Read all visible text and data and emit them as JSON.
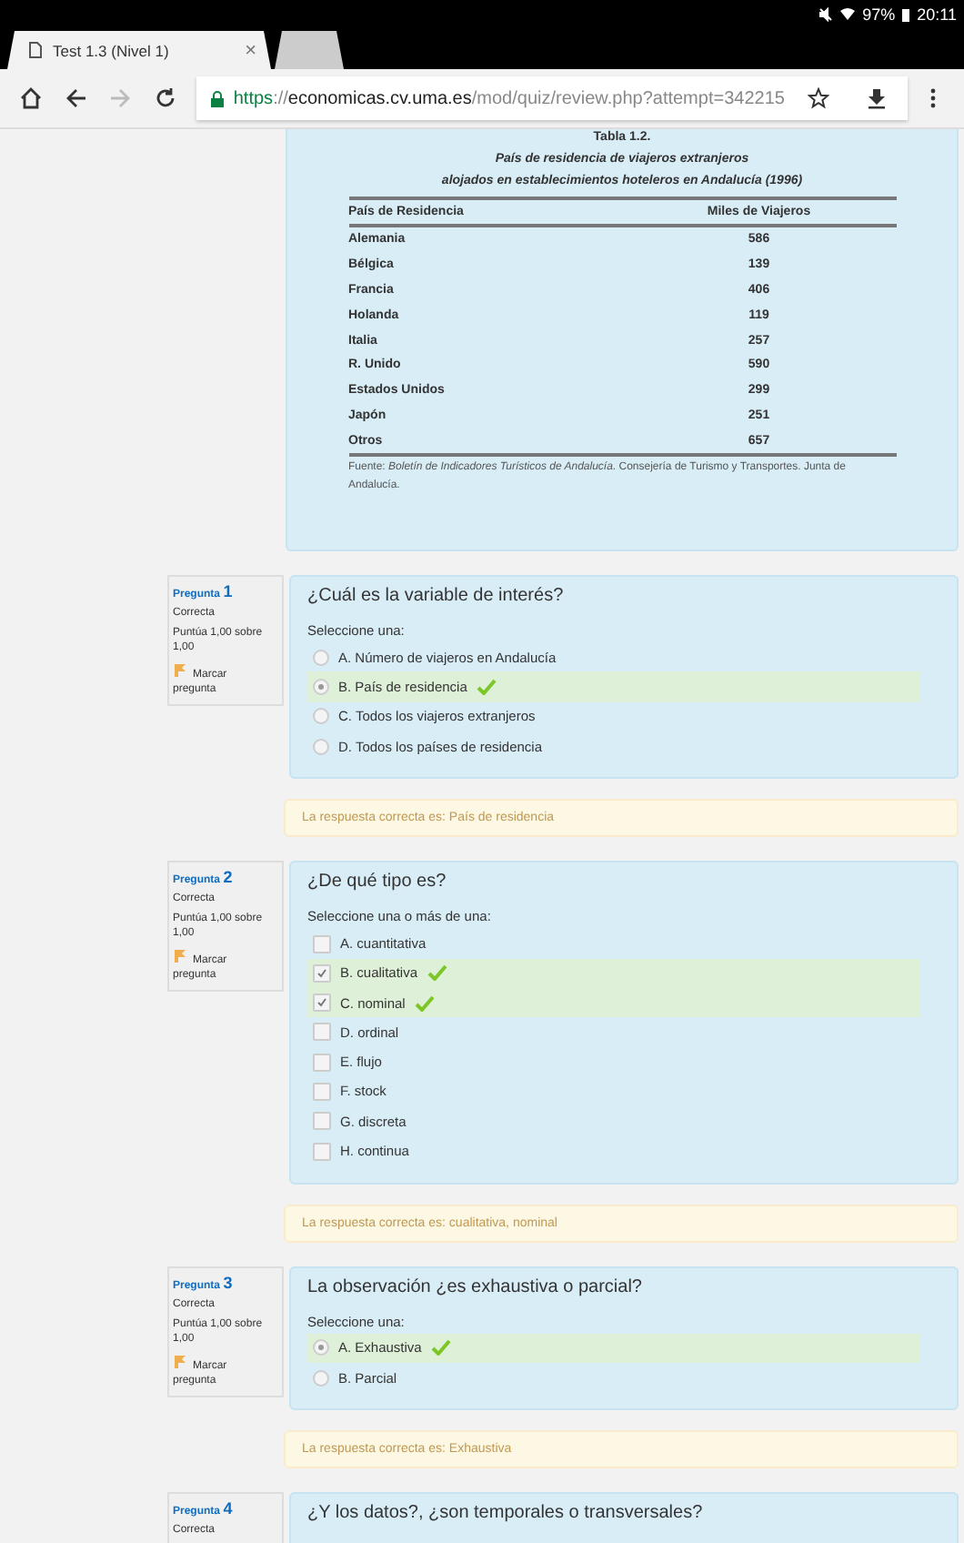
{
  "status_bar": {
    "battery": "97%",
    "time": "20:11"
  },
  "tabs": [
    {
      "title": "Test 1.3 (Nivel 1)",
      "close": "×",
      "selected": true
    },
    {
      "selected": false
    }
  ],
  "address_bar": {
    "url": [
      {
        "kind": "scheme",
        "text": "https"
      },
      {
        "kind": "path",
        "text": "://"
      },
      {
        "kind": "host",
        "text": "economicas.cv.uma.es"
      },
      {
        "kind": "path",
        "text": "/mod/quiz/review.php?attempt=342215"
      }
    ]
  },
  "table": {
    "caption": "Tabla 1.2.",
    "subtitle_lines": [
      "País de residencia de viajeros extranjeros",
      "alojados en establecimientos hoteleros en Andalucía (1996)"
    ],
    "columns": [
      "País de Residencia",
      "Miles de Viajeros"
    ],
    "rows": [
      [
        "Alemania",
        "586"
      ],
      [
        "Bélgica",
        "139"
      ],
      [
        "Francia",
        "406"
      ],
      [
        "Holanda",
        "119"
      ],
      [
        "Italia",
        "257"
      ],
      [
        "R. Unido",
        "590"
      ],
      [
        "Estados Unidos",
        "299"
      ],
      [
        "Japón",
        "251"
      ],
      [
        "Otros",
        "657"
      ]
    ],
    "source": "Fuente: *Boletín de Indicadores Turísticos de Andalucía*. Consejería de Turismo y Transportes. Junta de Andalucía."
  },
  "questions": [
    {
      "label": "Pregunta",
      "number": "1",
      "status": "Correcta",
      "grade": "Puntúa 1,00 sobre 1,00",
      "flag": "Marcar pregunta",
      "text": "¿Cuál es la variable de interés?",
      "prompt": "Seleccione una:",
      "kind": "radio",
      "options": [
        {
          "text": "A. Número de viajeros en Andalucía",
          "selected": false,
          "correct": false
        },
        {
          "text": "B. País de residencia",
          "selected": true,
          "correct": true
        },
        {
          "text": "C. Todos los viajeros extranjeros",
          "selected": false,
          "correct": false
        },
        {
          "text": "D. Todos los países de residencia",
          "selected": false,
          "correct": false
        }
      ],
      "feedback": "La respuesta correcta es: País de residencia"
    },
    {
      "label": "Pregunta",
      "number": "2",
      "status": "Correcta",
      "grade": "Puntúa 1,00 sobre 1,00",
      "flag": "Marcar pregunta",
      "text": "¿De qué tipo es?",
      "prompt": "Seleccione una o más de una:",
      "kind": "checkbox",
      "options": [
        {
          "text": "A. cuantitativa",
          "selected": false,
          "correct": false
        },
        {
          "text": "B. cualitativa",
          "selected": true,
          "correct": true
        },
        {
          "text": "C. nominal",
          "selected": true,
          "correct": true
        },
        {
          "text": "D. ordinal",
          "selected": false,
          "correct": false
        },
        {
          "text": "E. flujo",
          "selected": false,
          "correct": false
        },
        {
          "text": "F. stock",
          "selected": false,
          "correct": false
        },
        {
          "text": "G. discreta",
          "selected": false,
          "correct": false
        },
        {
          "text": "H. continua",
          "selected": false,
          "correct": false
        }
      ],
      "feedback": "La respuesta correcta es: cualitativa, nominal"
    },
    {
      "label": "Pregunta",
      "number": "3",
      "status": "Correcta",
      "grade": "Puntúa 1,00 sobre 1,00",
      "flag": "Marcar pregunta",
      "text": "La observación ¿es exhaustiva o parcial?",
      "prompt": "Seleccione una:",
      "kind": "radio",
      "options": [
        {
          "text": "A. Exhaustiva",
          "selected": true,
          "correct": true
        },
        {
          "text": "B. Parcial",
          "selected": false,
          "correct": false
        }
      ],
      "feedback": "La respuesta correcta es: Exhaustiva"
    },
    {
      "label": "Pregunta",
      "number": "4",
      "status": "Correcta",
      "text": "¿Y los datos?, ¿son temporales o transversales?"
    }
  ]
}
